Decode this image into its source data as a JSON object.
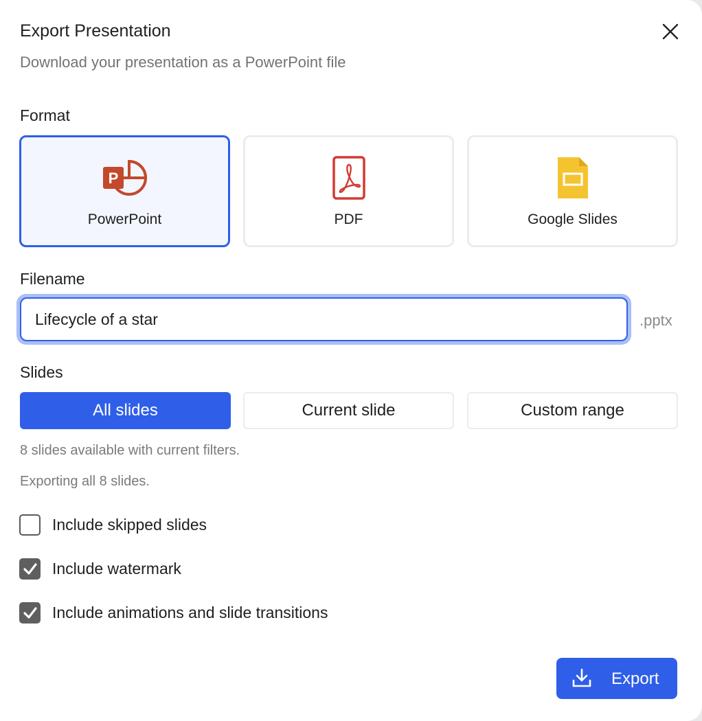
{
  "dialog": {
    "title": "Export Presentation",
    "subtitle": "Download your presentation as a PowerPoint file",
    "close_icon": "close-icon"
  },
  "format": {
    "label": "Format",
    "options": [
      {
        "label": "PowerPoint",
        "icon": "powerpoint-icon",
        "selected": true
      },
      {
        "label": "PDF",
        "icon": "pdf-icon",
        "selected": false
      },
      {
        "label": "Google Slides",
        "icon": "google-slides-icon",
        "selected": false
      }
    ]
  },
  "filename": {
    "label": "Filename",
    "value": "Lifecycle of a star",
    "extension": ".pptx"
  },
  "slides": {
    "label": "Slides",
    "options": [
      {
        "label": "All slides",
        "selected": true
      },
      {
        "label": "Current slide",
        "selected": false
      },
      {
        "label": "Custom range",
        "selected": false
      }
    ],
    "available_text": "8 slides available with current filters.",
    "exporting_text": "Exporting all 8 slides."
  },
  "options": [
    {
      "label": "Include skipped slides",
      "checked": false
    },
    {
      "label": "Include watermark",
      "checked": true
    },
    {
      "label": "Include animations and slide transitions",
      "checked": true
    }
  ],
  "export_button": {
    "label": "Export",
    "icon": "download-icon"
  },
  "colors": {
    "accent": "#2f5fe8",
    "powerpoint": "#c4482c",
    "pdf": "#d13b34",
    "google_slides": "#f4c430"
  }
}
